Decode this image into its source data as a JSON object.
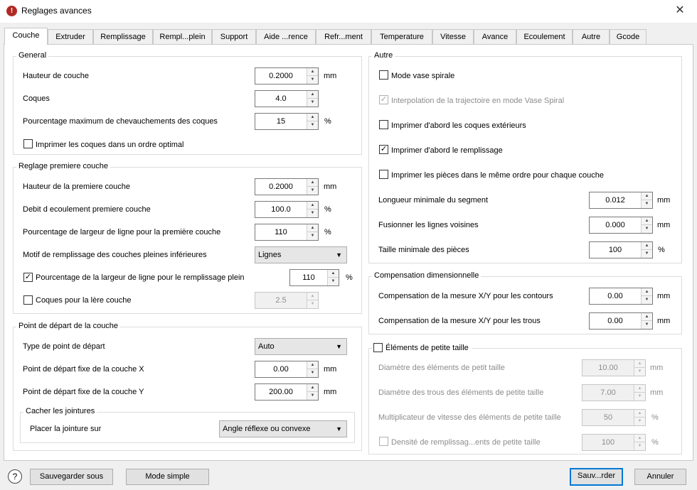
{
  "window": {
    "title": "Reglages avances",
    "app_icon": "app-logo-icon",
    "close_icon": "close-icon"
  },
  "tabs": [
    "Couche",
    "Extruder",
    "Remplissage",
    "Rempl...plein",
    "Support",
    "Aide ...rence",
    "Refr...ment",
    "Temperature",
    "Vitesse",
    "Avance",
    "Ecoulement",
    "Autre",
    "Gcode"
  ],
  "active_tab": "Couche",
  "general": {
    "title": "General",
    "layer_height": {
      "label": "Hauteur de couche",
      "value": "0.2000",
      "unit": "mm"
    },
    "shells": {
      "label": "Coques",
      "value": "4.0"
    },
    "overlap": {
      "label": "Pourcentage maximum de chevauchements des coques",
      "value": "15",
      "unit": "%"
    },
    "optimal_order": {
      "label": "Imprimer les coques dans un ordre optimal",
      "checked": false
    }
  },
  "first_layer": {
    "title": "Reglage premiere couche",
    "height": {
      "label": "Hauteur de la premiere couche",
      "value": "0.2000",
      "unit": "mm"
    },
    "flow": {
      "label": "Debit d ecoulement premiere couche",
      "value": "100.0",
      "unit": "%"
    },
    "line_width": {
      "label": "Pourcentage de largeur de ligne pour la première couche",
      "value": "110",
      "unit": "%"
    },
    "fill_pattern": {
      "label": "Motif de remplissage des couches pleines inférieures",
      "value": "Lignes"
    },
    "solid_fill_width": {
      "label": "Pourcentage de la largeur de ligne pour le remplissage plein",
      "value": "110",
      "unit": "%",
      "checked": true
    },
    "first_shells": {
      "label": "Coques pour la lère couche",
      "value": "2.5",
      "checked": false
    }
  },
  "start_point": {
    "title": "Point de départ de la couche",
    "type": {
      "label": "Type de point de départ",
      "value": "Auto"
    },
    "fixed_x": {
      "label": "Point de départ fixe de la couche X",
      "value": "0.00",
      "unit": "mm"
    },
    "fixed_y": {
      "label": "Point de départ fixe de la couche Y",
      "value": "200.00",
      "unit": "mm"
    },
    "seams": {
      "title": "Cacher les jointures",
      "place": {
        "label": "Placer la jointure sur",
        "value": "Angle réflexe ou convexe"
      }
    }
  },
  "autre": {
    "title": "Autre",
    "spiral_vase": {
      "label": "Mode vase spirale",
      "checked": false
    },
    "spiral_interp": {
      "label": "Interpolation de la trajectoire en mode Vase Spiral",
      "checked": true
    },
    "outer_first": {
      "label": "Imprimer d'abord les coques extérieurs",
      "checked": false
    },
    "infill_first": {
      "label": "Imprimer d'abord le remplissage",
      "checked": true
    },
    "same_order": {
      "label": "Imprimer les pièces dans le même ordre pour chaque couche",
      "checked": false
    },
    "min_segment": {
      "label": "Longueur minimale du segment",
      "value": "0.012",
      "unit": "mm"
    },
    "merge_lines": {
      "label": "Fusionner les lignes voisines",
      "value": "0.000",
      "unit": "mm"
    },
    "min_part": {
      "label": "Taille minimale des pièces",
      "value": "100",
      "unit": "%"
    }
  },
  "compensation": {
    "title": "Compensation dimensionnelle",
    "outline": {
      "label": "Compensation de la mesure X/Y pour les contours",
      "value": "0.00",
      "unit": "mm"
    },
    "holes": {
      "label": "Compensation de la mesure X/Y pour les trous",
      "value": "0.00",
      "unit": "mm"
    }
  },
  "small_features": {
    "title": "Éléments de petite taille",
    "checked": false,
    "diameter": {
      "label": "Diamètre des éléments de petit taille",
      "value": "10.00",
      "unit": "mm"
    },
    "hole_diameter": {
      "label": "Diamètre des trous des éléments de petite taille",
      "value": "7.00",
      "unit": "mm"
    },
    "speed_mult": {
      "label": "Multiplicateur de vitesse des éléments de petite taille",
      "value": "50",
      "unit": "%"
    },
    "infill_density": {
      "label": "Densité de remplissag...ents de petite taille",
      "value": "100",
      "unit": "%",
      "checked": false
    }
  },
  "footer": {
    "help": "?",
    "save_as": "Sauvegarder sous",
    "simple_mode": "Mode simple",
    "save": "Sauv...rder",
    "cancel": "Annuler"
  },
  "glyphs": {
    "check": "✓",
    "up": "▲",
    "down": "▼",
    "caret": "▼",
    "close": "✕",
    "app": "!"
  }
}
